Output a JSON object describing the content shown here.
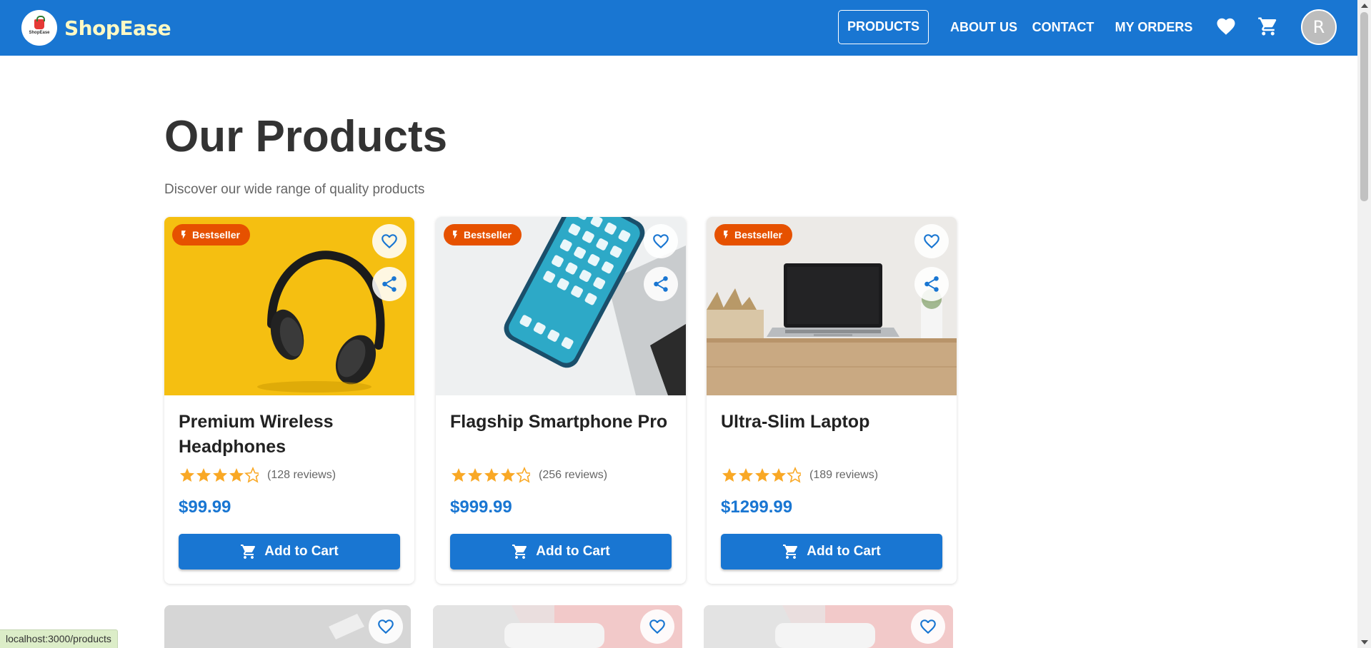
{
  "header": {
    "brand": "ShopEase",
    "logo_text": "ShopEase",
    "nav": [
      {
        "label": "PRODUCTS",
        "active": true
      },
      {
        "label": "ABOUT US"
      },
      {
        "label": "CONTACT"
      },
      {
        "label": "MY ORDERS"
      }
    ],
    "wishlist_icon": "heart-icon",
    "cart_icon": "shopping-cart-icon",
    "avatar_initial": "R"
  },
  "main": {
    "title": "Our Products",
    "subtitle": "Discover our wide range of quality products"
  },
  "products": [
    {
      "badge": "Bestseller",
      "name": "Premium Wireless Headphones",
      "rating": 4.5,
      "reviews": "(128 reviews)",
      "price": "$99.99",
      "button": "Add to Cart",
      "image": "headphones"
    },
    {
      "badge": "Bestseller",
      "name": "Flagship Smartphone Pro",
      "rating": 4.5,
      "reviews": "(256 reviews)",
      "price": "$999.99",
      "button": "Add to Cart",
      "image": "smartphone"
    },
    {
      "badge": "Bestseller",
      "name": "Ultra-Slim Laptop",
      "rating": 4.5,
      "reviews": "(189 reviews)",
      "price": "$1299.99",
      "button": "Add to Cart",
      "image": "laptop"
    }
  ],
  "status_bar": {
    "url": "localhost:3000/products"
  },
  "colors": {
    "primary": "#1976d2",
    "badge": "#e65100",
    "star": "#f9a825",
    "brand_text": "#fff9c4"
  }
}
